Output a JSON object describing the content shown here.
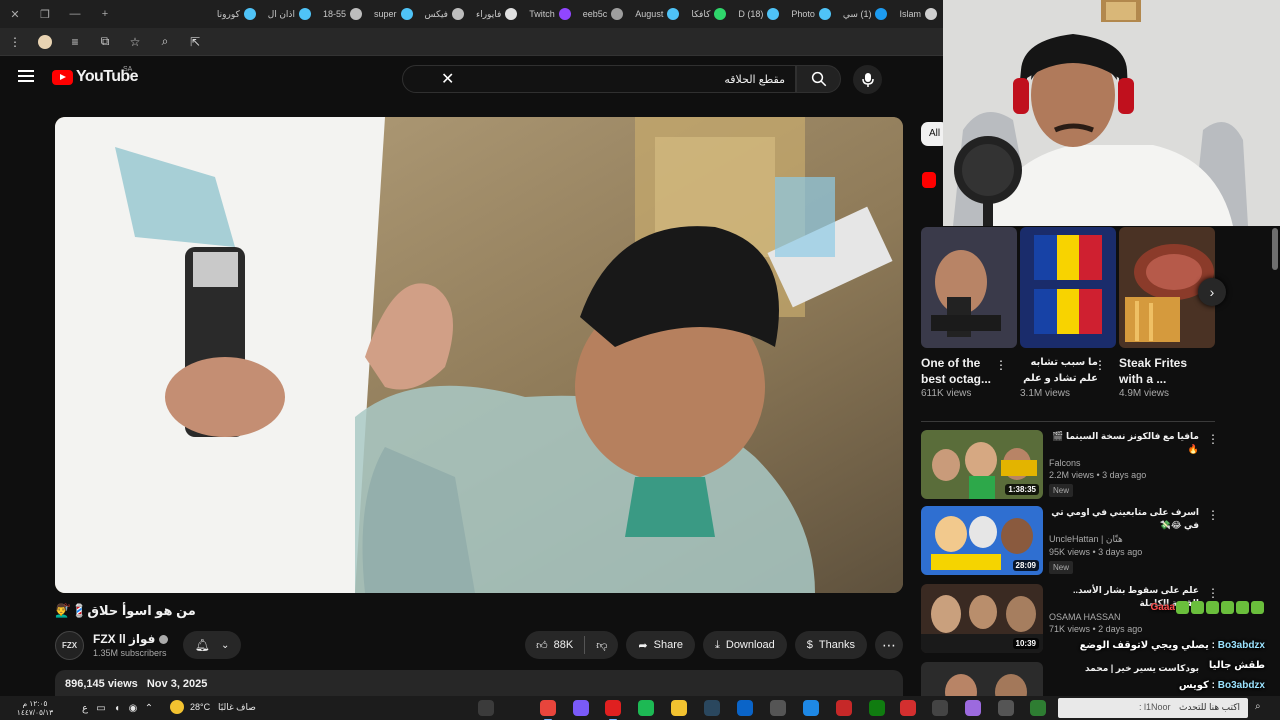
{
  "browser": {
    "tabs": [
      {
        "label": "Islam",
        "color": "#cfcfcf"
      },
      {
        "label": "(1) سي",
        "color": "#1d9bf0"
      },
      {
        "label": "Photo",
        "color": "#4fc3f7"
      },
      {
        "label": "(18) D",
        "color": "#4fc3f7"
      },
      {
        "label": "كافكا",
        "color": "#2fd66b"
      },
      {
        "label": "August",
        "color": "#4fc3f7"
      },
      {
        "label": "eeb5c",
        "color": "#9e9e9e"
      },
      {
        "label": "Twitch",
        "color": "#9146ff"
      },
      {
        "label": "فايوراء",
        "color": "#e0e0e0"
      },
      {
        "label": "فيكس",
        "color": "#bdbdbd"
      },
      {
        "label": "super",
        "color": "#4fc3f7"
      },
      {
        "label": "18-55",
        "color": "#bdbdbd"
      },
      {
        "label": "اذان ال",
        "color": "#4fc3f7"
      },
      {
        "label": "كورونا",
        "color": "#4fc3f7"
      }
    ],
    "new_tab": "+"
  },
  "youtube": {
    "logo_text": "YouTube",
    "region": "SA",
    "search": {
      "value": "مقطع الحلاقه"
    }
  },
  "video": {
    "title": "من هو اسوأ حلاق💈💇‍♂️",
    "channel": {
      "name": "FZX ll فواز",
      "subscribers": "1.35M subscribers",
      "avatar_text": "FZX"
    },
    "likes": "88K",
    "share_label": "Share",
    "download_label": "Download",
    "thanks_label": "Thanks",
    "views": "896,145 views",
    "date": "Nov 3, 2025"
  },
  "sidebar": {
    "chip_all": "All",
    "shorts": [
      {
        "title": "One of the best octag...",
        "views": "611K views",
        "rtl": false
      },
      {
        "title": "ما سبب تشابه علم تشاد و علم رومانيا",
        "views": "3.1M views",
        "rtl": true
      },
      {
        "title": "Steak Frites with a ...",
        "views": "4.9M views",
        "rtl": false
      }
    ],
    "recommendations": [
      {
        "title": "مافيا مع فالكونز نسخة السينما 🎬🔥",
        "channel": "Falcons",
        "meta": "2.2M views • 3 days ago",
        "badge": "New",
        "duration": "1:38:35"
      },
      {
        "title": "اسرف على متابعيني في اومي تي في 😂💸",
        "channel": "UncleHattan | هتّان",
        "meta": "95K views • 3 days ago",
        "badge": "New",
        "duration": "28:09"
      },
      {
        "title": "علم على سقوط بشار الأسد.. القصة الكاملة",
        "channel": "OSAMA HASSAN",
        "meta": "71K views • 2 days ago",
        "badge": "",
        "duration": "10:39"
      },
      {
        "title": "بودكاست يسير خير | محمد",
        "channel": "",
        "meta": "",
        "badge": "",
        "duration": ""
      }
    ]
  },
  "chat": {
    "lines": [
      {
        "name": "",
        "text": "Gaaa"
      },
      {
        "name": "Bo3abdzx",
        "text": "يصلي ويجي لاتوقف الوضع"
      },
      {
        "name": "",
        "text": "طقش جاليا"
      },
      {
        "name": "Bo3abdzx",
        "text": "كويس"
      }
    ],
    "input_placeholder": "اكتب هنا للتحدث",
    "input_user": "l1Noor :"
  },
  "taskbar": {
    "weather_temp": "28°C",
    "weather_text": "صاف غالبًا",
    "time": "١٢:٠٥ م",
    "date": "١٤٤٧/٠٥/١٣"
  },
  "colors": {
    "youtube_red": "#ff0000",
    "bg": "#0f0f0f",
    "pill": "#272727"
  }
}
